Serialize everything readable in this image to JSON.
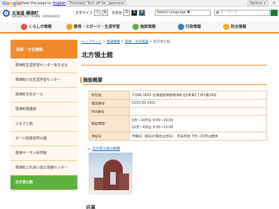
{
  "google_bar": {
    "logo_letters": [
      "G",
      "o",
      "o",
      "g",
      "l",
      "e"
    ],
    "view_text": "View this page in:",
    "language_link": "English",
    "translate_button": "Translate",
    "turn_off_text": "Turn off for: Japanese",
    "options_button": "Options ▾",
    "close": "×"
  },
  "header": {
    "town_jp": "北海道 標津町",
    "town_en": "SHIBETSU TOWN, HOKKAIDO",
    "font_size_label": "文字サイズ",
    "font_small": "小",
    "font_large": "大",
    "bg_color_label": "背景色",
    "bg_white": "白",
    "bg_black": "黒",
    "bg_yellow": "黄",
    "select_language": "Select Language ▼",
    "search_placeholder": "キーワード"
  },
  "nav": {
    "items": [
      {
        "label": "くらしの情報",
        "color": "#e9524a"
      },
      {
        "label": "教育・スポーツ・生涯学習",
        "color": "#f0a020"
      },
      {
        "label": "施設情報",
        "color": "#5cb03b"
      },
      {
        "label": "行政情報",
        "color": "#2f7fc4"
      },
      {
        "label": "防災情報",
        "color": "#e9b21a"
      }
    ]
  },
  "sidebar": {
    "header": "芸術・文化施設",
    "items": [
      {
        "label": "標津町生涯学習センターあすぱる",
        "active": false
      },
      {
        "label": "標津町川北生涯学習センター",
        "active": false
      },
      {
        "label": "標津町文化ホール",
        "active": false
      },
      {
        "label": "標津町図書館",
        "active": false
      },
      {
        "label": "ふるさと館",
        "active": false
      },
      {
        "label": "ポー川史跡自然公園",
        "active": false
      },
      {
        "label": "標津サーモン科学館",
        "active": false
      },
      {
        "label": "標津町ふれあい加工体験センター",
        "active": false
      },
      {
        "label": "北方領土館",
        "active": true
      }
    ]
  },
  "breadcrumb": {
    "items": [
      "トップページ",
      "施設情報",
      "芸術・文化施設",
      "北方領土館"
    ],
    "separator": " > "
  },
  "page": {
    "title": "北方領土館",
    "section_title": "施設概要",
    "table": [
      {
        "label": "所在地",
        "value": "〒086-1632 北海道標津郡標津町北2条東1丁目1番14号"
      },
      {
        "label": "電話番号",
        "value": "0153-82-2422"
      },
      {
        "label": "FAX番号",
        "value": ""
      },
      {
        "label": "開館時間",
        "value": "5月～10月は 9:00～16:00",
        "value2": "11月～6月は 9:00～15:00"
      },
      {
        "label": "休館日",
        "value": "月曜日（祝日の場合は翌日）、年末年始 7月～10月は無休"
      }
    ],
    "photo_link": "北方領土館の概要",
    "photo_alt": "北方領土館 外観",
    "next_section": "沿革"
  }
}
